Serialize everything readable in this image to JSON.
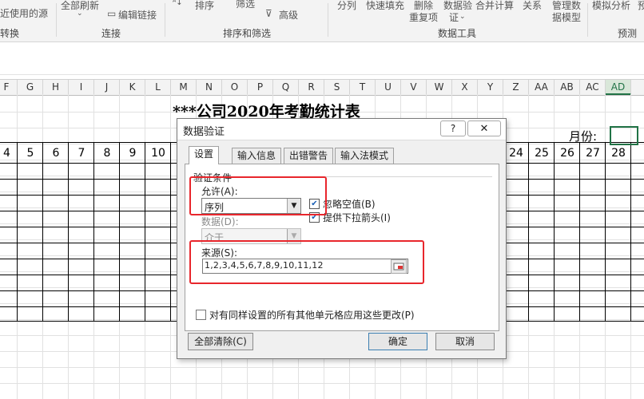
{
  "ribbon": {
    "items": [
      "近使用的源",
      "全部刷新",
      "编辑链接",
      "排序",
      "筛选",
      "高级",
      "分列",
      "快速填充",
      "删除",
      "重复项",
      "数据验",
      "证",
      "合并计算",
      "关系",
      "管理数",
      "据模型",
      "模拟分析",
      "预"
    ],
    "groups": [
      "转换",
      "连接",
      "排序和筛选",
      "数据工具",
      "预测"
    ]
  },
  "columns": [
    "F",
    "G",
    "H",
    "I",
    "J",
    "K",
    "L",
    "M",
    "N",
    "O",
    "P",
    "Q",
    "R",
    "S",
    "T",
    "U",
    "V",
    "W",
    "X",
    "Y",
    "Z",
    "AA",
    "AB",
    "AC",
    "AD"
  ],
  "selected_column": "AD",
  "sheet": {
    "title": "***公司2020年考勤统计表",
    "month_label": "月份:",
    "days_left": [
      "4",
      "5",
      "6",
      "7",
      "8",
      "9",
      "10"
    ],
    "days_right": [
      "24",
      "25",
      "26",
      "27",
      "28"
    ]
  },
  "dialog": {
    "title": "数据验证",
    "help": "?",
    "close": "✕",
    "tabs": [
      "设置",
      "输入信息",
      "出错警告",
      "输入法模式"
    ],
    "criteria_label": "验证条件",
    "allow_label": "允许(A):",
    "allow_value": "序列",
    "ignore_blank": "忽略空值(B)",
    "dropdown": "提供下拉箭头(I)",
    "data_label": "数据(D):",
    "data_value": "介于",
    "source_label": "来源(S):",
    "source_value": "1,2,3,4,5,6,7,8,9,10,11,12",
    "apply_all": "对有同样设置的所有其他单元格应用这些更改(P)",
    "clear_all": "全部清除(C)",
    "ok": "确定",
    "cancel": "取消"
  },
  "colors": {
    "accent": "#217346",
    "highlight": "#e8262c"
  }
}
